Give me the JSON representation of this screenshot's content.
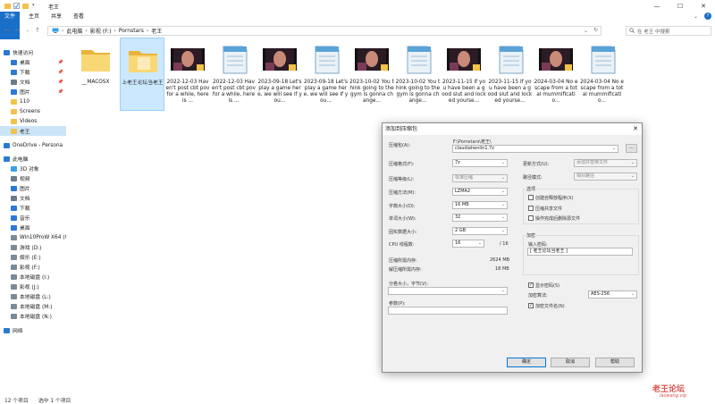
{
  "window": {
    "title": "老王",
    "controls": {
      "minimize": "—",
      "maximize": "☐",
      "close": "✕"
    }
  },
  "ribbon": {
    "tabs": [
      "文件",
      "主页",
      "共享",
      "查看"
    ]
  },
  "address": {
    "path": [
      "此电脑",
      "影视 (F:)",
      "Pornstars",
      "老王"
    ],
    "search_placeholder": "在 老王 中搜索"
  },
  "nav": {
    "items": [
      {
        "label": "快速访问",
        "icon": "star-icon",
        "color": "#2b79d6",
        "pinned": false,
        "selected": false
      },
      {
        "label": "桌面",
        "icon": "desktop-icon",
        "color": "#2b79d6",
        "pinned": true,
        "selected": false
      },
      {
        "label": "下载",
        "icon": "download-icon",
        "color": "#2b79d6",
        "pinned": true,
        "selected": false
      },
      {
        "label": "文档",
        "icon": "document-icon",
        "color": "#6b7b8c",
        "pinned": true,
        "selected": false
      },
      {
        "label": "图片",
        "icon": "picture-icon",
        "color": "#2b79d6",
        "pinned": true,
        "selected": false
      },
      {
        "label": "110",
        "icon": "folder-icon",
        "color": "#f2c24a",
        "pinned": false,
        "selected": false
      },
      {
        "label": "Screens",
        "icon": "folder-icon",
        "color": "#f2c24a",
        "pinned": false,
        "selected": false
      },
      {
        "label": "Videos",
        "icon": "folder-icon",
        "color": "#f2c24a",
        "pinned": false,
        "selected": false
      },
      {
        "label": "老王",
        "icon": "folder-icon",
        "color": "#f2c24a",
        "pinned": false,
        "selected": true
      },
      {
        "label": "OneDrive - Persona",
        "icon": "cloud-icon",
        "color": "#2b79d6",
        "pinned": false,
        "selected": false
      },
      {
        "label": "此电脑",
        "icon": "computer-icon",
        "color": "#2b79d6",
        "pinned": false,
        "selected": false
      },
      {
        "label": "3D 对象",
        "icon": "cube-icon",
        "color": "#3aa0e8",
        "pinned": false,
        "selected": false
      },
      {
        "label": "视频",
        "icon": "video-icon",
        "color": "#6b7b8c",
        "pinned": false,
        "selected": false
      },
      {
        "label": "图片",
        "icon": "picture-icon",
        "color": "#2b79d6",
        "pinned": false,
        "selected": false
      },
      {
        "label": "文档",
        "icon": "document-icon",
        "color": "#6b7b8c",
        "pinned": false,
        "selected": false
      },
      {
        "label": "下载",
        "icon": "download-icon",
        "color": "#2b79d6",
        "pinned": false,
        "selected": false
      },
      {
        "label": "音乐",
        "icon": "music-icon",
        "color": "#2b79d6",
        "pinned": false,
        "selected": false
      },
      {
        "label": "桌面",
        "icon": "desktop-icon",
        "color": "#2b79d6",
        "pinned": false,
        "selected": false
      },
      {
        "label": "Win10ProW X64 (C",
        "icon": "drive-icon",
        "color": "#7a8a99",
        "pinned": false,
        "selected": false
      },
      {
        "label": "游戏 (D:)",
        "icon": "drive-icon",
        "color": "#7a8a99",
        "pinned": false,
        "selected": false
      },
      {
        "label": "娱乐 (E:)",
        "icon": "drive-icon",
        "color": "#7a8a99",
        "pinned": false,
        "selected": false
      },
      {
        "label": "影视 (F:)",
        "icon": "drive-icon",
        "color": "#7a8a99",
        "pinned": false,
        "selected": false
      },
      {
        "label": "本地磁盘 (I:)",
        "icon": "drive-icon",
        "color": "#7a8a99",
        "pinned": false,
        "selected": false
      },
      {
        "label": "影视 (J:)",
        "icon": "drive-icon",
        "color": "#7a8a99",
        "pinned": false,
        "selected": false
      },
      {
        "label": "本地磁盘 (L:)",
        "icon": "drive-icon",
        "color": "#7a8a99",
        "pinned": false,
        "selected": false
      },
      {
        "label": "本地磁盘 (M:)",
        "icon": "drive-icon",
        "color": "#7a8a99",
        "pinned": false,
        "selected": false
      },
      {
        "label": "本地磁盘 (N:)",
        "icon": "drive-icon",
        "color": "#7a8a99",
        "pinned": false,
        "selected": false
      },
      {
        "label": "网络",
        "icon": "network-icon",
        "color": "#2b79d6",
        "pinned": false,
        "selected": false
      }
    ]
  },
  "files": [
    {
      "name": "__MACOSX",
      "type": "folder",
      "selected": false
    },
    {
      "name": "上老王论坛当老王",
      "type": "folder",
      "selected": true
    },
    {
      "name": "2022-12-03 Haven't post cbt pov for a while, here is ...",
      "type": "video",
      "selected": false
    },
    {
      "name": "2022-12-03 Haven't post cbt pov for a while, here is ...",
      "type": "notepad",
      "selected": false
    },
    {
      "name": "2023-09-18 Let's play a game here, we will see if you...",
      "type": "video",
      "selected": false
    },
    {
      "name": "2023-09-18 Let's play a game here, we will see if you...",
      "type": "notepad",
      "selected": false
    },
    {
      "name": "2023-10-02 You think going to the gym is gonna change...",
      "type": "video",
      "selected": false
    },
    {
      "name": "2023-10-02 You think going to the gym is gonna change...",
      "type": "notepad",
      "selected": false
    },
    {
      "name": "2023-11-15 If you have been a good slut and locked yourse...",
      "type": "video",
      "selected": false
    },
    {
      "name": "2023-11-15 If you have been a good slut and locked yourse...",
      "type": "notepad",
      "selected": false
    },
    {
      "name": "2024-03-04 No escape from a total mummificatio...",
      "type": "video",
      "selected": false
    },
    {
      "name": "2024-03-04 No escape from a total mummificatio...",
      "type": "notepad",
      "selected": false
    }
  ],
  "status": {
    "count": "12 个项目",
    "selected": "选中 1 个项目"
  },
  "dialog": {
    "title": "添加到压缩包",
    "archive_label": "压缩包(A):",
    "archive_dir": "F:\\Pornstars\\老王\\",
    "archive_name": "claudiahenlin1.7z",
    "browse_label": "...",
    "left": [
      {
        "label": "压缩格式(F):",
        "value": "7z",
        "disabled": false
      },
      {
        "label": "压缩等级(L):",
        "value": "标准压缩",
        "disabled": true
      },
      {
        "label": "压缩方法(M):",
        "value": "LZMA2",
        "disabled": false
      },
      {
        "label": "字典大小(D):",
        "value": "16 MB",
        "disabled": false
      },
      {
        "label": "单词大小(W):",
        "value": "32",
        "disabled": false
      },
      {
        "label": "固实数据大小:",
        "value": "2 GB",
        "disabled": false
      },
      {
        "label": "CPU 线程数:",
        "value": "16",
        "disabled": false
      }
    ],
    "cpu_total": "/ 16",
    "mem_comp_label": "压缩所需内存:",
    "mem_comp_value": "2624 MB",
    "mem_decomp_label": "解压缩所需内存:",
    "mem_decomp_value": "18 MB",
    "split_label": "分卷大小，字节(V):",
    "params_label": "参数(P):",
    "right": [
      {
        "label": "更新方式(U):",
        "value": "添加并替换文件"
      },
      {
        "label": "路径模式:",
        "value": "相对路径"
      }
    ],
    "options_title": "选项",
    "options": [
      {
        "label": "创建自释放程序(X)",
        "checked": false
      },
      {
        "label": "压缩共享文件",
        "checked": false
      },
      {
        "label": "操作完成后删除源文件",
        "checked": false
      }
    ],
    "encrypt_title": "加密",
    "password_label": "输入密码:",
    "password_value": "[ 老王论坛当老王 ]",
    "show_password": {
      "label": "显示密码(S)",
      "checked": true
    },
    "method_label": "加密算法:",
    "method_value": "AES-256",
    "encrypt_names": {
      "label": "加密文件名(N)",
      "checked": true
    },
    "buttons": {
      "ok": "确定",
      "cancel": "取消",
      "help": "帮助"
    }
  },
  "watermark": {
    "text": "老王论坛",
    "sub": "laowang.vip",
    "color": "#d9534f"
  },
  "colors": {
    "accent": "#1a6fc9",
    "selection": "#cce8ff",
    "folder": "#f2c24a"
  }
}
